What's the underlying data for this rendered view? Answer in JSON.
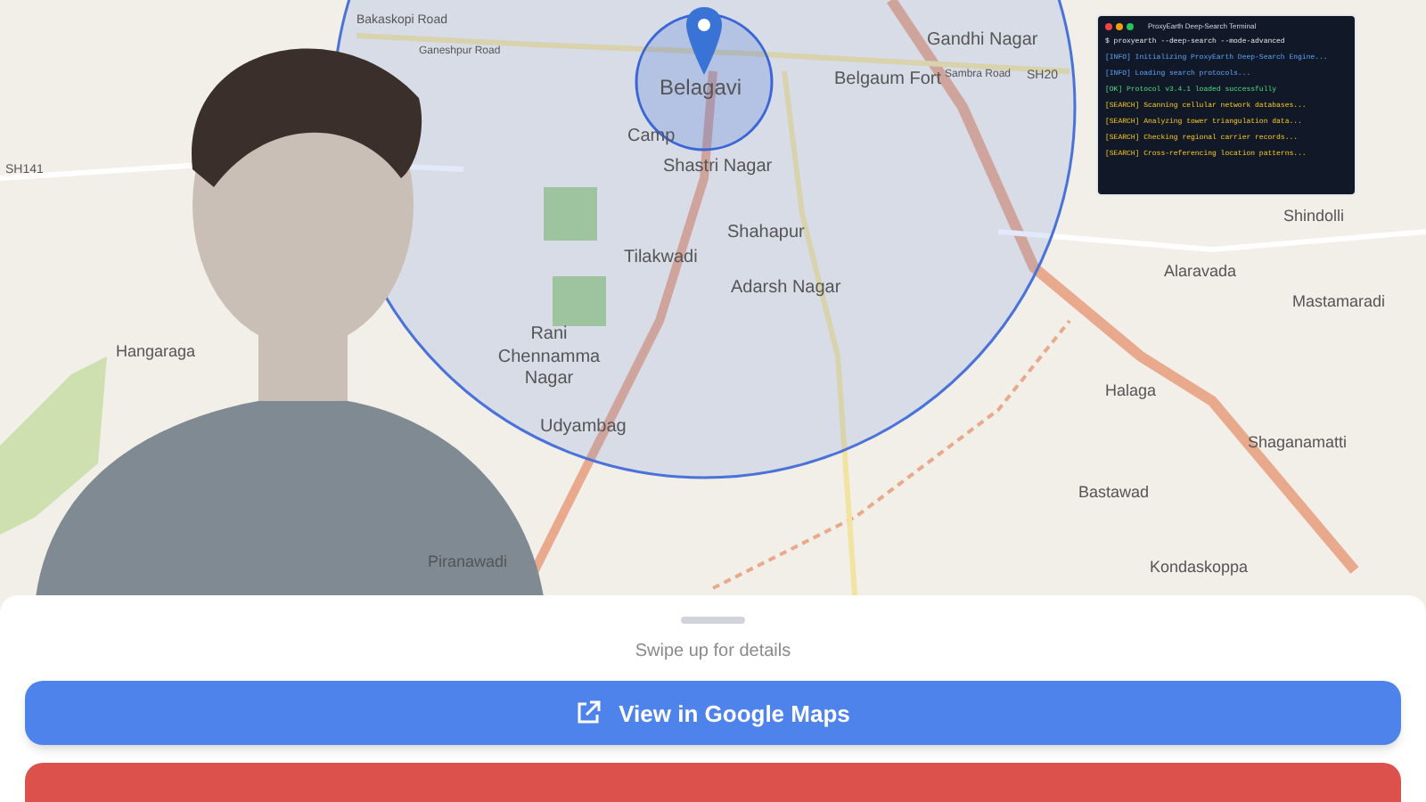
{
  "map": {
    "labels": [
      "Bakaskopi Road",
      "Ganeshpur Road",
      "Gandhi Nagar",
      "Belagavi",
      "Belgaum Fort",
      "Sambra Road",
      "SH20",
      "Camp",
      "Shastri Nagar",
      "Shahapur",
      "Tilakwadi",
      "Adarsh Nagar",
      "Rani Chennamma Nagar",
      "Udyambag",
      "Piranawadi",
      "Hangaraga",
      "SH141",
      "Shindolli",
      "Alaravada",
      "Mastamaradi",
      "Halaga",
      "Shaganamatti",
      "Bastawad",
      "Kondaskoppa"
    ]
  },
  "terminal": {
    "title": "ProxyEarth Deep-Search Terminal",
    "lines": [
      {
        "kind": "command",
        "text": "$ proxyearth --deep-search --mode-advanced"
      },
      {
        "kind": "info",
        "text": "[INFO] Initializing ProxyEarth Deep-Search Engine..."
      },
      {
        "kind": "info",
        "text": "[INFO] Loading search protocols..."
      },
      {
        "kind": "ok",
        "text": "[OK] Protocol v3.4.1 loaded successfully"
      },
      {
        "kind": "search",
        "text": "[SEARCH] Scanning cellular network databases..."
      },
      {
        "kind": "search",
        "text": "[SEARCH] Analyzing tower triangulation data..."
      },
      {
        "kind": "search",
        "text": "[SEARCH] Checking regional carrier records..."
      },
      {
        "kind": "search",
        "text": "[SEARCH] Cross-referencing location patterns..."
      }
    ]
  },
  "sheet": {
    "hint": "Swipe up for details",
    "primary_button": "View in Google Maps"
  }
}
